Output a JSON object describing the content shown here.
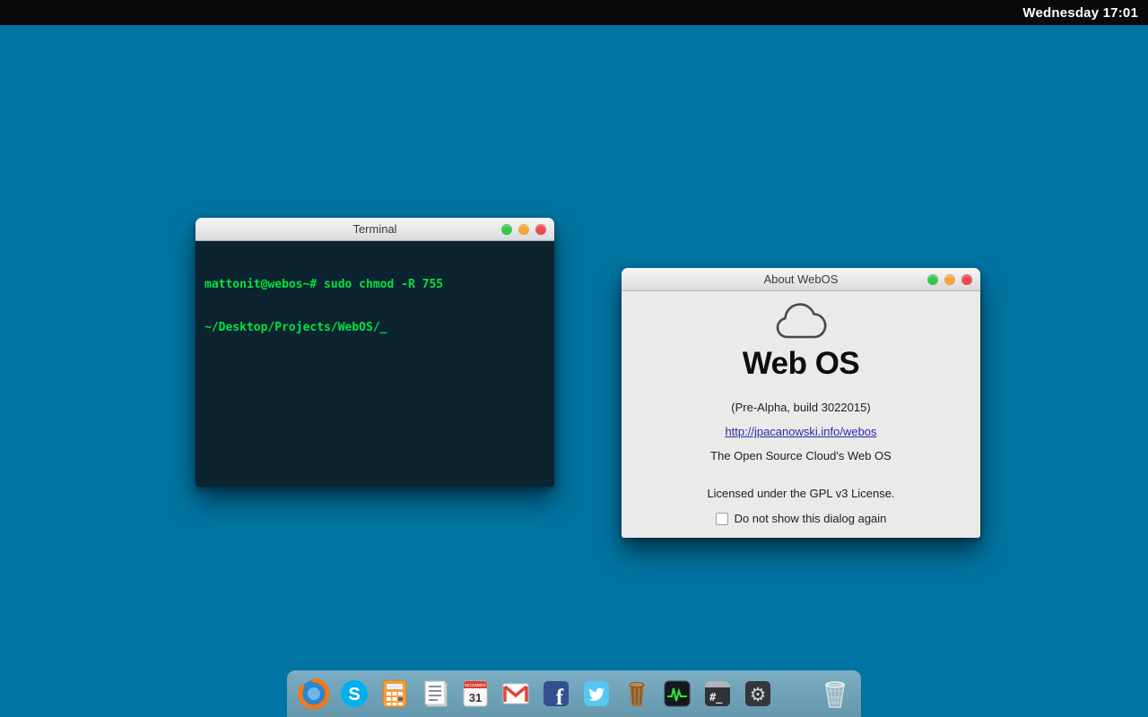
{
  "menubar": {
    "clock": "Wednesday 17:01"
  },
  "terminal_window": {
    "title": "Terminal",
    "lines": [
      "mattonit@webos~# sudo chmod -R 755",
      "~/Desktop/Projects/WebOS/_"
    ]
  },
  "about_window": {
    "title": "About WebOS",
    "app_name": "Web OS",
    "build_info": "(Pre-Alpha, build 3022015)",
    "link": "http://jpacanowski.info/webos",
    "tagline": "The Open Source Cloud's Web OS",
    "license": "Licensed under the GPL v3 License.",
    "checkbox_label": "Do not show this dialog again"
  },
  "dock": {
    "icons": [
      "firefox",
      "skype",
      "calculator",
      "notes",
      "calendar",
      "gmail",
      "facebook",
      "twitter",
      "bin",
      "activity-monitor",
      "terminal",
      "settings",
      "trash"
    ],
    "skype_letter": "S",
    "facebook_letter": "f",
    "terminal_glyph": "#_",
    "calendar_month": "DECEMBER",
    "calendar_day": "31",
    "gear_glyph": "⚙"
  },
  "colors": {
    "desktop": "#0074a2",
    "menubar": "#0a0a0a",
    "terminal_background": "#0c2330",
    "terminal_text": "#00e53e",
    "dialog_background": "#eaeae8",
    "link": "#2a2aac",
    "light_green": "#36c94c",
    "light_yellow": "#f7a738",
    "light_red": "#f1484e"
  }
}
